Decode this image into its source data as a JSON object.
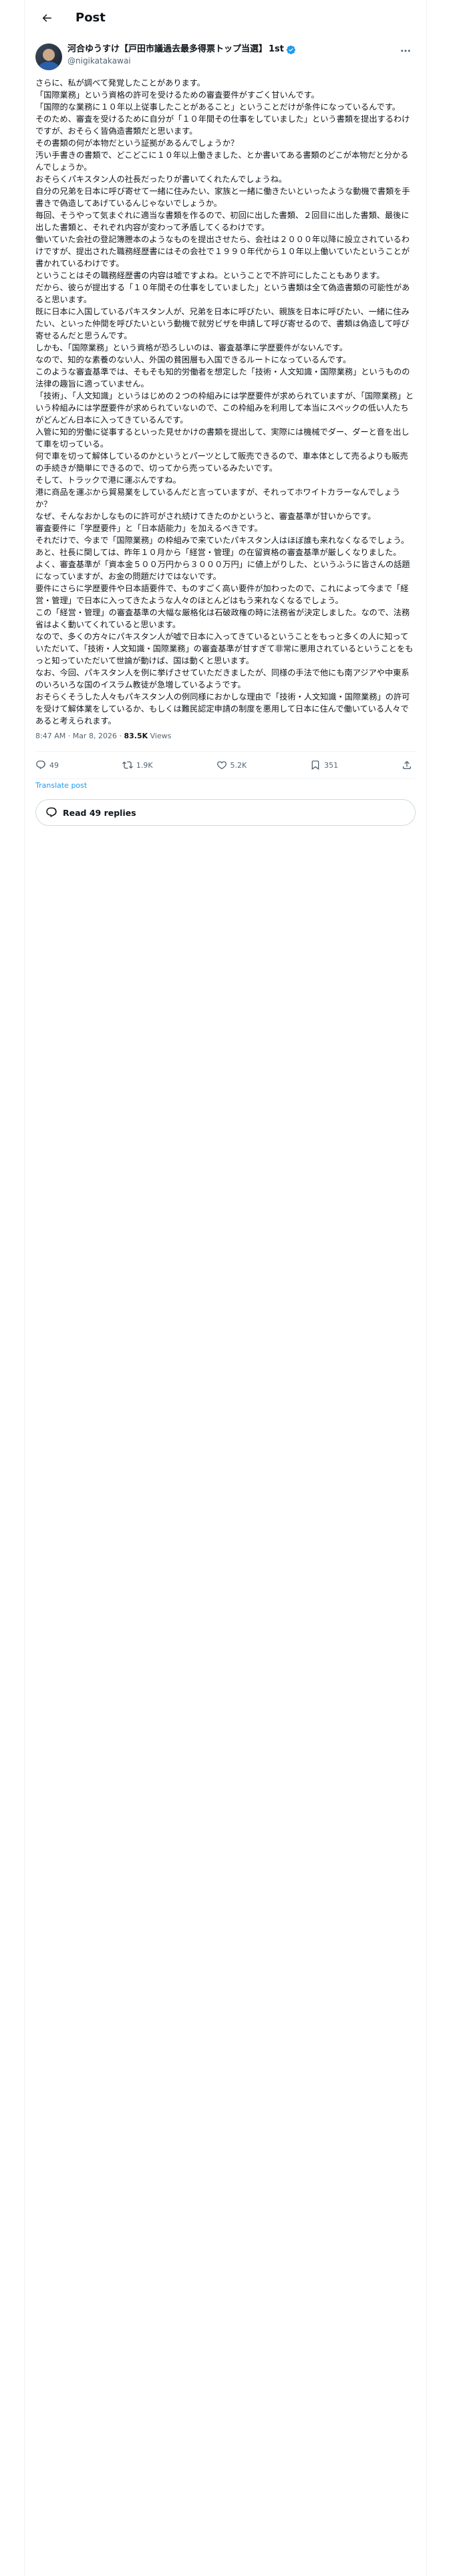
{
  "header": {
    "title": "Post"
  },
  "author": {
    "name": "河合ゆうすけ【戸田市議過去最多得票トップ当選】",
    "badge": "1st",
    "handle": "@nigikatakawai"
  },
  "post": {
    "paragraphs": [
      "さらに、私が調べて発覚したことがあります。",
      "「国際業務」という資格の許可を受けるための審査要件がすごく甘いんです。",
      "「国際的な業務に１０年以上従事したことがあること」ということだけが条件になっているんです。",
      "そのため、審査を受けるために自分が「１０年間その仕事をしていました」という書類を提出するわけですが、おそらく皆偽造書類だと思います。",
      "その書類の何が本物だという証拠があるんでしょうか？",
      "汚い手書きの書類で、どこどこに１０年以上働きました、とか書いてある書類のどこが本物だと分かるんでしょうか。",
      "おそらくパキスタン人の社長だったりが書いてくれたんでしょうね。",
      "自分の兄弟を日本に呼び寄せて一緒に住みたい、家族と一緒に働きたいといったような動機で書類を手書きで偽造してあげているんじゃないでしょうか。",
      "毎回、そうやって気まぐれに適当な書類を作るので、初回に出した書類、２回目に出した書類、最後に出した書類と、それぞれ内容が変わって矛盾してくるわけです。",
      "働いていた会社の登記簿謄本のようなものを提出させたら、会社は２０００年以降に設立されているわけですが、提出された職務経歴書にはその会社で１９９０年代から１０年以上働いていたということが書かれているわけです。",
      "ということはその職務経歴書の内容は嘘ですよね。ということで不許可にしたこともあります。",
      "だから、彼らが提出する「１０年間その仕事をしていました」という書類は全て偽造書類の可能性があると思います。",
      "既に日本に入国しているパキスタン人が、兄弟を日本に呼びたい、親族を日本に呼びたい、一緒に住みたい、といった仲間を呼びたいという動機で就労ビザを申請して呼び寄せるので、書類は偽造して呼び寄せるんだと思うんです。",
      "しかも、「国際業務」という資格が恐ろしいのは、審査基準に学歴要件がないんです。",
      "なので、知的な素養のない人、外国の貧困層も入国できるルートになっているんです。",
      "このような審査基準では、そもそも知的労働者を想定した「技術・人文知識・国際業務」というものの法律の趣旨に適っていません。",
      "「技術」、「人文知識」というはじめの２つの枠組みには学歴要件が求められていますが、「国際業務」という枠組みには学歴要件が求められていないので、この枠組みを利用して本当にスペックの低い人たちがどんどん日本に入ってきているんです。",
      "入管に知的労働に従事するといった見せかけの書類を提出して、実際には機械でダー、ダーと音を出して車を切っている。",
      "何で車を切って解体しているのかというとパーツとして販売できるので、車本体として売るよりも販売の手続きが簡単にできるので、切ってから売っているみたいです。",
      "そして、トラックで港に運ぶんですね。",
      "港に商品を運ぶから貿易業をしているんだと言っていますが、それってホワイトカラーなんでしょうか？",
      "なぜ、そんなおかしなものに許可がされ続けてきたのかというと、審査基準が甘いからです。",
      "審査要件に「学歴要件」と「日本語能力」を加えるべきです。",
      "それだけで、今まで「国際業務」の枠組みで来ていたパキスタン人はほぼ誰も来れなくなるでしょう。",
      "あと、社長に関しては、昨年１０月から「経営・管理」の在留資格の審査基準が厳しくなりました。",
      "よく、審査基準が「資本金５００万円から３０００万円」に値上がりした、というふうに皆さんの話題になっていますが、お金の問題だけではないです。",
      "要件にさらに学歴要件や日本語要件で、ものすごく高い要件が加わったので、これによって今まで「経営・管理」で日本に入ってきたような人々のほとんどはもう来れなくなるでしょう。",
      "この「経営・管理」の審査基準の大幅な厳格化は石破政権の時に法務省が決定しました。なので、法務省はよく動いてくれていると思います。",
      "なので、多くの方々にパキスタン人が嘘で日本に入ってきているということをもっと多くの人に知っていただいて、「技術・人文知識・国際業務」の審査基準が甘すぎて非常に悪用されているということをもっと知っていただいて世論が動けば、国は動くと思います。",
      "なお、今回、パキスタン人を例に挙げさせていただきましたが、同様の手法で他にも南アジアや中東系のいろいろな国のイスラム教徒が急増しているようです。",
      "おそらくそうした人々もパキスタン人の例同様におかしな理由で「技術・人文知識・国際業務」の許可を受けて解体業をしているか、もしくは難民認定申請の制度を悪用して日本に住んで働いている人々であると考えられます。"
    ],
    "timestamp": "8:47 AM · Mar 8, 2026",
    "separator": " · ",
    "views": "83.5K",
    "views_label": " Views"
  },
  "actions": {
    "replies": "49",
    "reposts": "1.9K",
    "likes": "5.2K",
    "bookmarks": "351"
  },
  "translate": "Translate post",
  "read_replies": "Read 49 replies"
}
